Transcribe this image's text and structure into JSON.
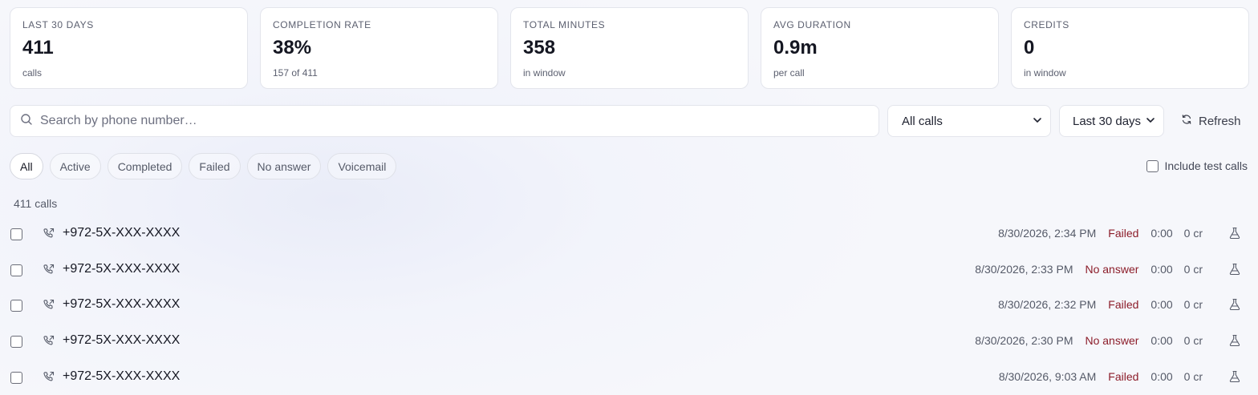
{
  "stats": [
    {
      "label": "LAST 30 DAYS",
      "value": "411",
      "sub": "calls"
    },
    {
      "label": "COMPLETION RATE",
      "value": "38%",
      "sub": "157 of 411"
    },
    {
      "label": "TOTAL MINUTES",
      "value": "358",
      "sub": "in window"
    },
    {
      "label": "AVG DURATION",
      "value": "0.9m",
      "sub": "per call"
    },
    {
      "label": "CREDITS",
      "value": "0",
      "sub": "in window"
    }
  ],
  "search": {
    "placeholder": "Search by phone number…",
    "value": ""
  },
  "filters": {
    "type_selected": "All calls",
    "range_selected": "Last 30 days",
    "refresh_label": "Refresh"
  },
  "chips": [
    "All",
    "Active",
    "Completed",
    "Failed",
    "No answer",
    "Voicemail"
  ],
  "active_chip": "All",
  "include_test_label": "Include test calls",
  "count_label": "411 calls",
  "calls": [
    {
      "phone": "+972-5X-XXX-XXXX",
      "datetime": "8/30/2026, 2:34 PM",
      "status": "Failed",
      "duration": "0:00",
      "credits": "0 cr"
    },
    {
      "phone": "+972-5X-XXX-XXXX",
      "datetime": "8/30/2026, 2:33 PM",
      "status": "No answer",
      "duration": "0:00",
      "credits": "0 cr"
    },
    {
      "phone": "+972-5X-XXX-XXXX",
      "datetime": "8/30/2026, 2:32 PM",
      "status": "Failed",
      "duration": "0:00",
      "credits": "0 cr"
    },
    {
      "phone": "+972-5X-XXX-XXXX",
      "datetime": "8/30/2026, 2:30 PM",
      "status": "No answer",
      "duration": "0:00",
      "credits": "0 cr"
    },
    {
      "phone": "+972-5X-XXX-XXXX",
      "datetime": "8/30/2026, 9:03 AM",
      "status": "Failed",
      "duration": "0:00",
      "credits": "0 cr"
    }
  ],
  "colors": {
    "status_text": "#8c1d2a",
    "card_border": "#e3e5ec",
    "background": "#f6f7fb"
  },
  "icons": {
    "search": "search-icon",
    "refresh": "refresh-icon",
    "chevron": "chevron-down-icon",
    "phone": "phone-outgoing-icon",
    "test": "flask-icon"
  }
}
